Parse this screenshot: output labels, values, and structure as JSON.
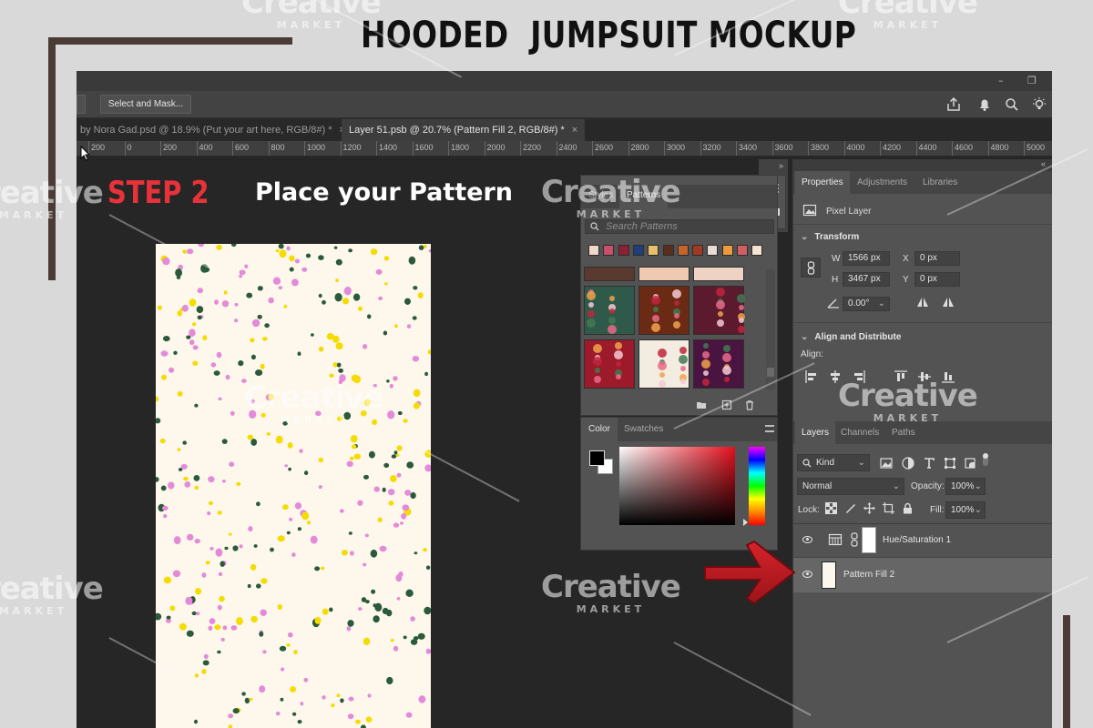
{
  "headline": "HOODED  JUMPSUIT MOCKUP",
  "optionsbar": {
    "select_mask_label": "Select and Mask..."
  },
  "tabs": [
    {
      "label": "by Nora Gad.psd @ 18.9% (Put your art here, RGB/8#) *",
      "close": "×"
    },
    {
      "label": "Layer 51.psb @ 20.7% (Pattern Fill 2, RGB/8#) *",
      "close": "×"
    }
  ],
  "ruler_labels": [
    "200",
    "0",
    "200",
    "400",
    "600",
    "800",
    "1000",
    "1200",
    "1400",
    "1600",
    "1800",
    "2000",
    "2200",
    "2400",
    "2600",
    "2800",
    "3000",
    "3200",
    "3400",
    "3600",
    "3800",
    "4000",
    "4200",
    "4400",
    "4600",
    "4800",
    "5000"
  ],
  "canvas": {
    "step_title": "STEP 2",
    "step_subtitle": "Place your Pattern"
  },
  "patterns_panel": {
    "tab_styles": "Styles",
    "tab_patterns": "Patterns",
    "search_placeholder": "Search Patterns",
    "mini_swatch_colors": [
      "#f2d6c9",
      "#c94f6a",
      "#8e2035",
      "#203f7a",
      "#e8c06b",
      "#5a2e1c",
      "#c5652a",
      "#a03a22",
      "#e9dcd2",
      "#ee9a3c",
      "#d25d63",
      "#f4e3d0"
    ],
    "grid_colors": [
      "#5a3a2e",
      "#efc9b0",
      "#eed2c4",
      "#2f5a4a",
      "#6b2a14",
      "#5b1a2e",
      "#9c1a2a",
      "#f3ece0",
      "#4a1440"
    ]
  },
  "color_panel": {
    "tab_color": "Color",
    "tab_swatches": "Swatches"
  },
  "properties": {
    "tab_properties": "Properties",
    "tab_adjustments": "Adjustments",
    "tab_libraries": "Libraries",
    "pixel_layer": "Pixel Layer",
    "transform_label": "Transform",
    "w_label": "W",
    "w_value": "1566 px",
    "h_label": "H",
    "h_value": "3467 px",
    "x_label": "X",
    "x_value": "0 px",
    "y_label": "Y",
    "y_value": "0 px",
    "angle_value": "0.00°",
    "align_label": "Align and Distribute",
    "align_sub": "Align:"
  },
  "layers": {
    "tab_layers": "Layers",
    "tab_channels": "Channels",
    "tab_paths": "Paths",
    "kind_label": "Kind",
    "blend_mode": "Normal",
    "opacity_label": "Opacity:",
    "opacity_value": "100%",
    "lock_label": "Lock:",
    "fill_label": "Fill:",
    "fill_value": "100%",
    "items": [
      {
        "name": "Hue/Saturation 1"
      },
      {
        "name": "Pattern Fill 2"
      }
    ]
  },
  "watermark": {
    "word": "Creative",
    "sub": "MARKET"
  },
  "colors": {
    "accent_red": "#e8323a",
    "frame_brown": "#4b3b37",
    "dot_green": "#2a5a3a",
    "dot_pink": "#e38ad9",
    "dot_yellow": "#f5dc00"
  }
}
